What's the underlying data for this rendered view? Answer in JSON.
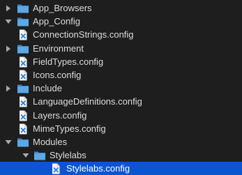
{
  "tree": {
    "items": [
      {
        "label": "App_Browsers",
        "type": "folder",
        "depth": 0,
        "expanded": false
      },
      {
        "label": "App_Config",
        "type": "folder",
        "depth": 0,
        "expanded": true
      },
      {
        "label": "ConnectionStrings.config",
        "type": "file",
        "depth": 1
      },
      {
        "label": "Environment",
        "type": "folder",
        "depth": 1,
        "expanded": false
      },
      {
        "label": "FieldTypes.config",
        "type": "file",
        "depth": 1
      },
      {
        "label": "Icons.config",
        "type": "file",
        "depth": 1
      },
      {
        "label": "Include",
        "type": "folder",
        "depth": 1,
        "expanded": false
      },
      {
        "label": "LanguageDefinitions.config",
        "type": "file",
        "depth": 1
      },
      {
        "label": "Layers.config",
        "type": "file",
        "depth": 1
      },
      {
        "label": "MimeTypes.config",
        "type": "file",
        "depth": 1
      },
      {
        "label": "Modules",
        "type": "folder",
        "depth": 1,
        "expanded": true
      },
      {
        "label": "Stylelabs",
        "type": "folder",
        "depth": 2,
        "expanded": true
      },
      {
        "label": "Stylelabs.config",
        "type": "file",
        "depth": 3,
        "selected": true
      }
    ]
  },
  "colors": {
    "background": "#1e1e1e",
    "text": "#dcdcdc",
    "selection": "#0a56d0",
    "folder": "#5aa9e6",
    "folder_tab": "#3f86c4",
    "file_page": "#f4f4f4",
    "file_mark": "#2a7fd4"
  }
}
